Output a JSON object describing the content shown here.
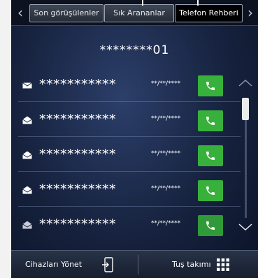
{
  "tabs": [
    {
      "label": "Son görüşülenler"
    },
    {
      "label": "Sık Arananlar"
    },
    {
      "label": "Telefon Rehberi",
      "active": true
    }
  ],
  "header": {
    "title": "********01"
  },
  "contacts": [
    {
      "name": "***********",
      "date": "**/**/****"
    },
    {
      "name": "***********",
      "date": "**/**/****"
    },
    {
      "name": "***********",
      "date": "**/**/****"
    },
    {
      "name": "***********",
      "date": "**/**/****"
    },
    {
      "name": "***********",
      "date": "**/**/****"
    }
  ],
  "bottom": {
    "manage_label": "Cihazları Yönet",
    "keypad_label": "Tuş takımı"
  },
  "colors": {
    "call_button": "#38b13c",
    "background": "#16223e",
    "tab_active": "#000000"
  },
  "icons": [
    "chevron-left-icon",
    "chevron-right-icon",
    "envelope-icon",
    "phone-icon",
    "chevron-up-icon",
    "chevron-down-icon",
    "phone-device-icon",
    "keypad-icon"
  ]
}
